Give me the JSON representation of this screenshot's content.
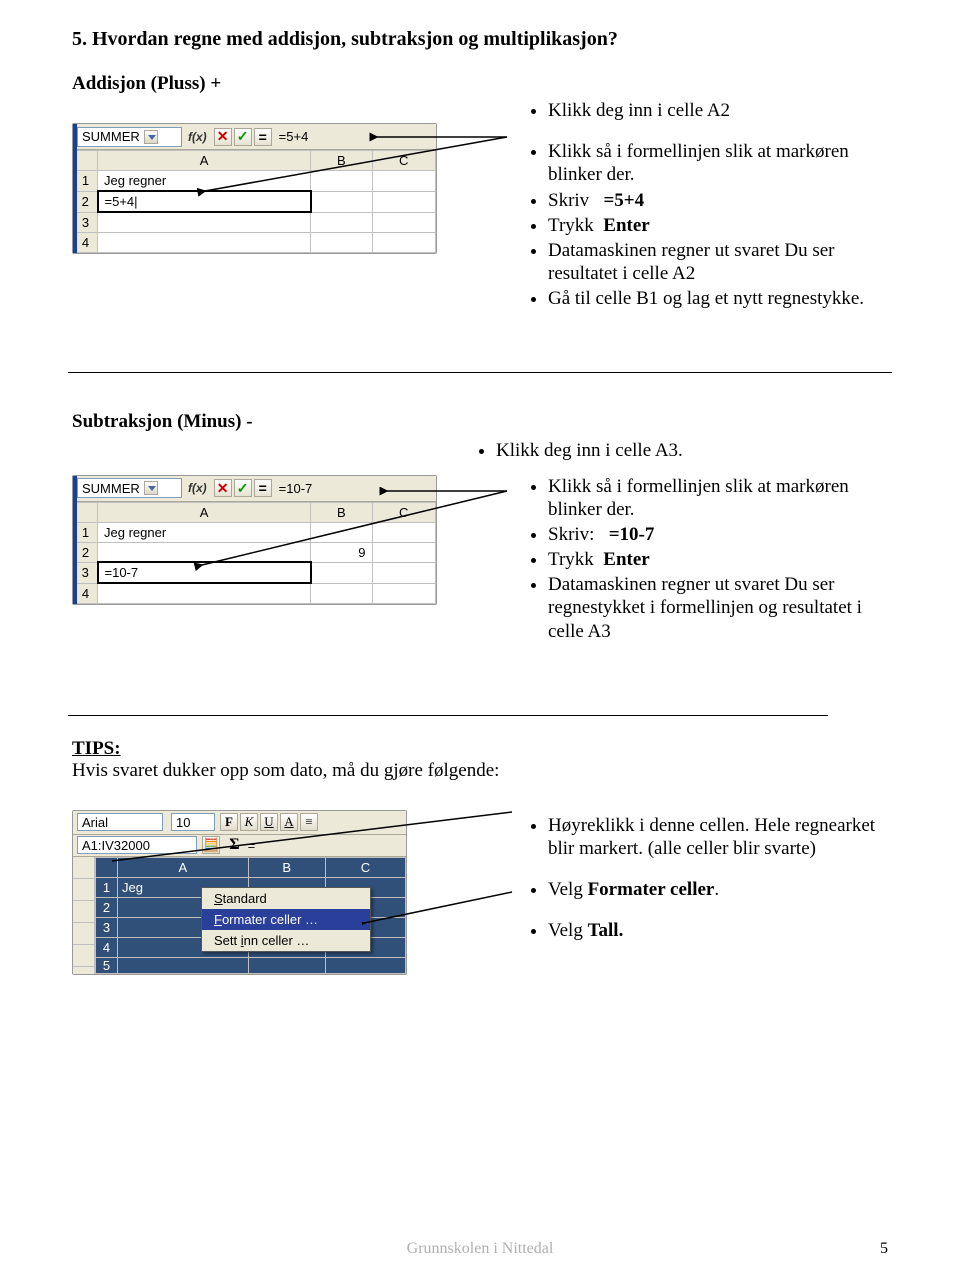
{
  "heading": "5. Hvordan regne med addisjon, subtraksjon og multiplikasjon?",
  "addition": {
    "title": "Addisjon (Pluss) +",
    "bullets_top": "Klikk deg inn i celle A2",
    "bullets": [
      "Klikk så i formellinjen slik at markøren blinker der.",
      "Skriv   =5+4",
      "Trykk  Enter",
      "Datamaskinen regner ut svaret Du ser resultatet i celle A2",
      "Gå til celle B1 og lag et nytt regnestykke."
    ],
    "shot": {
      "namebox": "SUMMER",
      "formula": "=5+4",
      "cols": [
        "A",
        "B",
        "C"
      ],
      "rows": [
        {
          "h": "1",
          "A": "Jeg regner",
          "B": "",
          "C": ""
        },
        {
          "h": "2",
          "A": "=5+4|",
          "B": "",
          "C": ""
        },
        {
          "h": "3",
          "A": "",
          "B": "",
          "C": ""
        },
        {
          "h": "4",
          "A": "",
          "B": "",
          "C": ""
        }
      ]
    }
  },
  "subtraction": {
    "title": "Subtraksjon  (Minus) -",
    "bullets_top": "Klikk deg inn i celle A3.",
    "bullets": [
      "Klikk så i formellinjen slik at markøren blinker der.",
      "Skriv:   =10-7",
      "Trykk  Enter",
      "Datamaskinen regner ut svaret Du ser regnestykket i formellinjen og resultatet i celle A3"
    ],
    "shot": {
      "namebox": "SUMMER",
      "formula": "=10-7",
      "cols": [
        "A",
        "B",
        "C"
      ],
      "rows": [
        {
          "h": "1",
          "A": "Jeg regner",
          "B": "",
          "C": ""
        },
        {
          "h": "2",
          "A": "",
          "B": "9",
          "C": ""
        },
        {
          "h": "3",
          "A": "=10-7",
          "B": "",
          "C": ""
        },
        {
          "h": "4",
          "A": "",
          "B": "",
          "C": ""
        }
      ]
    }
  },
  "tips": {
    "label": "TIPS:",
    "intro": "Hvis svaret dukker opp som dato, må du gjøre følgende:",
    "bullets": [
      "Høyreklikk i denne cellen. Hele regnearket blir markert. (alle celler blir svarte)",
      "Velg Formater celler.",
      "Velg Tall."
    ],
    "bold_phrases": {
      "b1": "=5+4",
      "b2": "Enter",
      "b3": "=10-7",
      "b4": "Enter",
      "b5": "Formater celler",
      "b6": "Tall."
    },
    "shot": {
      "font": "Arial",
      "size": "10",
      "ref": "A1:IV32000",
      "cols": [
        "A",
        "B",
        "C"
      ],
      "row1A": "Jeg",
      "menu": {
        "i1": "Standard",
        "i2": "Formater celler …",
        "i3": "Sett inn celler …"
      }
    }
  },
  "footer": {
    "center": "Grunnskolen i Nittedal",
    "page": "5"
  },
  "shot_labels": {
    "fx": "f(x)",
    "sigma": "Σ",
    "equals": "="
  }
}
